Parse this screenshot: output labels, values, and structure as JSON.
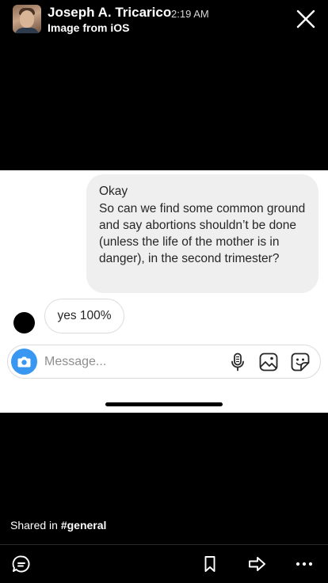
{
  "header": {
    "author": "Joseph A. Tricarico",
    "time": "2:19 AM",
    "subtitle": "Image from iOS",
    "close_icon": "close-icon"
  },
  "screenshot": {
    "outgoing_message": {
      "line1": "Okay",
      "line2": "So can we find some common ground and say abortions shouldn’t be done (unless the life of the mother is in danger), in the second trimester?"
    },
    "incoming_message": "yes 100%",
    "composer": {
      "placeholder": "Message...",
      "icons": [
        "camera-icon",
        "microphone-icon",
        "gallery-icon",
        "sticker-icon"
      ]
    }
  },
  "footer": {
    "shared_prefix": "Shared in",
    "channel": "#general",
    "toolbar_icons": [
      "comment-icon",
      "bookmark-icon",
      "share-icon",
      "more-icon"
    ]
  },
  "colors": {
    "background": "#000000",
    "bubble_out": "#efefef",
    "camera_button": "#3897f0"
  }
}
